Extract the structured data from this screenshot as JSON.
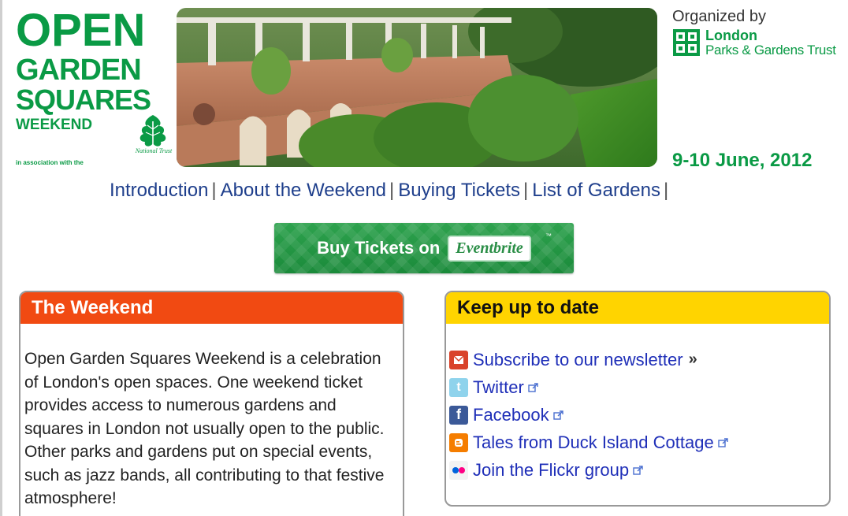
{
  "header": {
    "logo": {
      "line1": "OPEN",
      "line2": "GARDEN",
      "line3": "SQUARES",
      "line4": "WEEKEND",
      "association": "in association with the",
      "partner_label": "National Trust"
    },
    "organizer": {
      "label": "Organized by",
      "name_line1": "London",
      "name_line2": "Parks & Gardens Trust"
    },
    "date": "9-10 June, 2012"
  },
  "nav": {
    "items": [
      {
        "label": "Introduction"
      },
      {
        "label": "About the Weekend"
      },
      {
        "label": "Buying Tickets"
      },
      {
        "label": "List of Gardens"
      }
    ],
    "separator": "|"
  },
  "buy_button": {
    "label": "Buy Tickets on",
    "brand": "Eventbrite",
    "tm": "™"
  },
  "weekend_panel": {
    "title": "The Weekend",
    "body": "Open Garden Squares Weekend is a celebration of London's open spaces. One weekend ticket provides access to numerous gardens and squares in London not usually open to the public. Other parks and gardens put on special events, such as jazz bands, all contributing to that festive atmosphere!"
  },
  "keep_panel": {
    "title": "Keep up to date",
    "links": [
      {
        "label": "Subscribe to our newsletter",
        "icon": "newsletter-icon",
        "suffix": "»"
      },
      {
        "label": "Twitter",
        "icon": "twitter-icon"
      },
      {
        "label": "Facebook",
        "icon": "facebook-icon"
      },
      {
        "label": "Tales from Duck Island Cottage",
        "icon": "blogger-icon"
      },
      {
        "label": "Join the Flickr group",
        "icon": "flickr-icon"
      }
    ]
  },
  "colors": {
    "brand_green": "#0a9a45",
    "nav_blue": "#1f3f8c",
    "link_blue": "#1f2fb8",
    "panel_red": "#f14a12",
    "panel_yellow": "#ffd400"
  }
}
